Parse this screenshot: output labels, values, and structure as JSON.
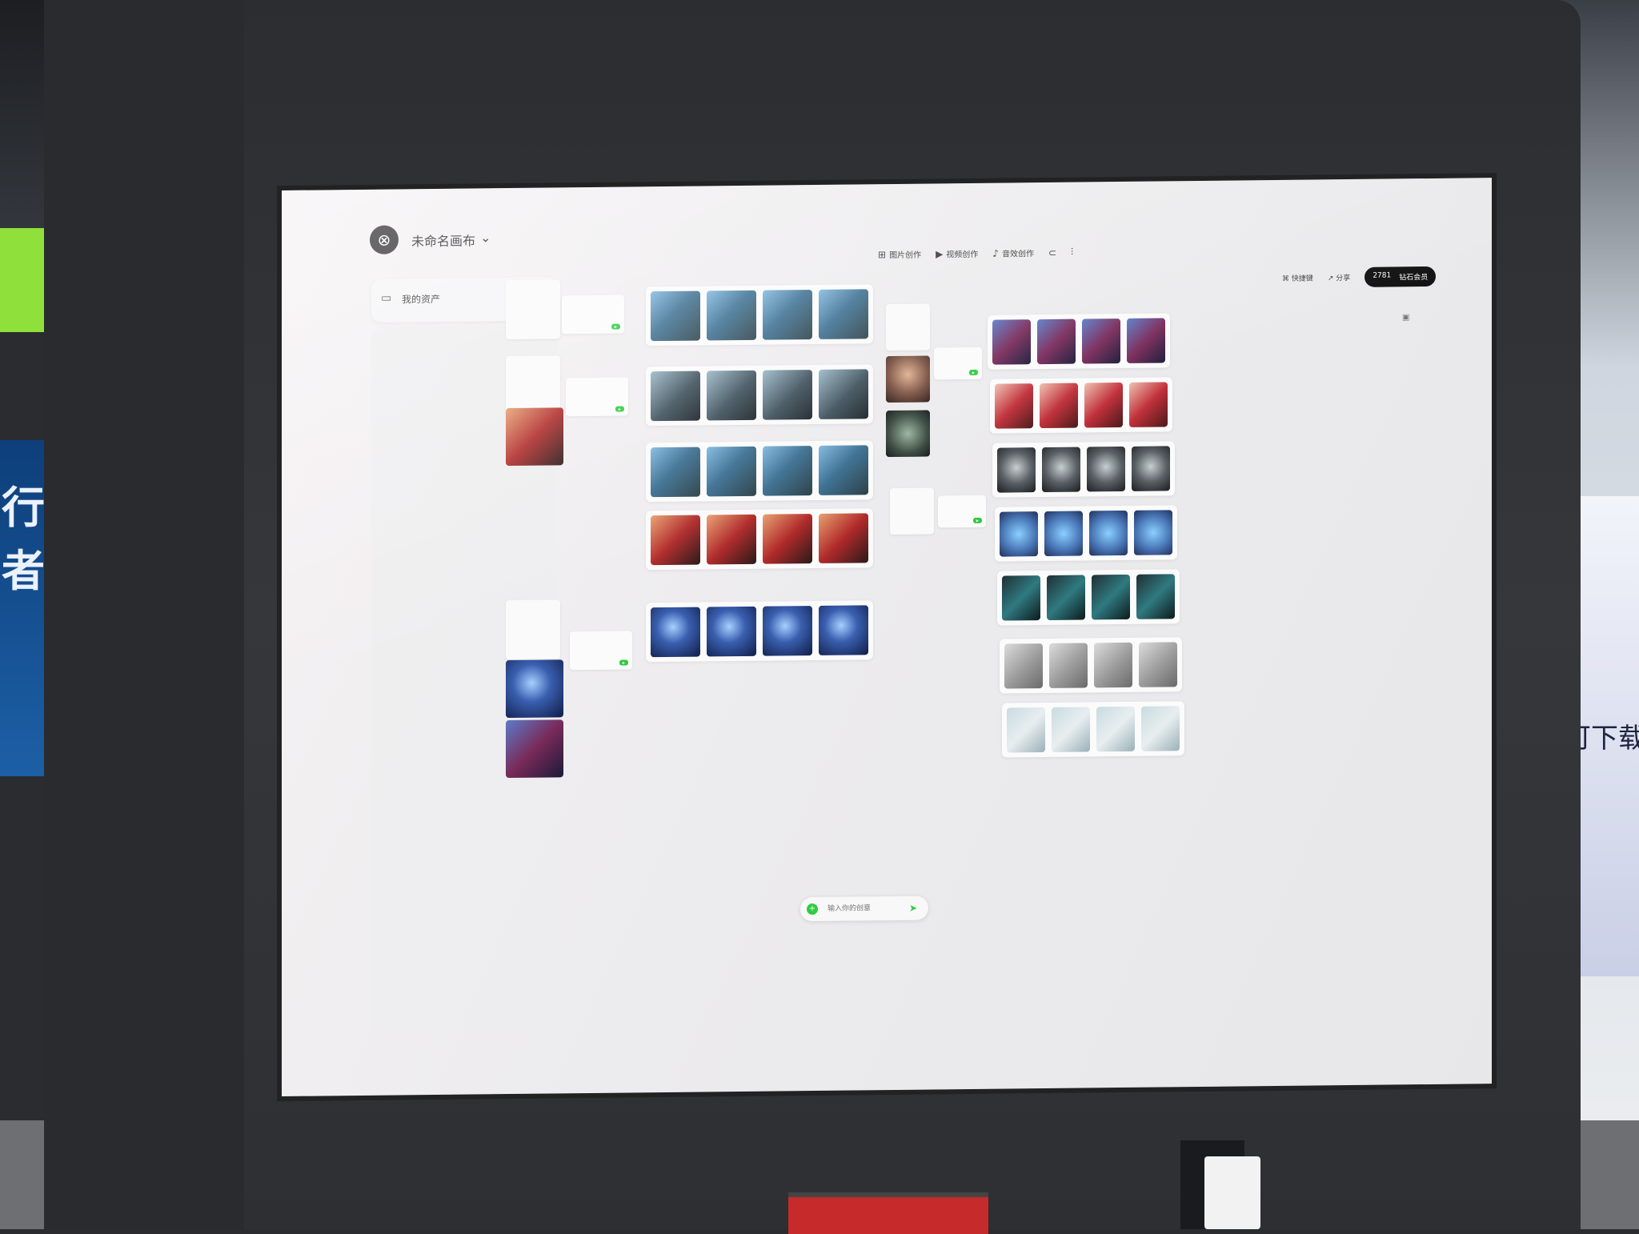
{
  "app": {
    "canvas_title": "未命名画布",
    "assets_label": "我的资产"
  },
  "toolbar": {
    "image_label": "图片创作",
    "video_label": "视频创作",
    "audio_label": "音效创作"
  },
  "top_right": {
    "shortcut_label": "快捷键",
    "share_label": "分享",
    "credits": "2781",
    "upgrade_label": "钻石会员"
  },
  "prompt": {
    "placeholder": "输入你的创意"
  },
  "background": {
    "left_sign": "行者",
    "right_sign": "即可下载"
  },
  "colors": {
    "accent": "#2ecc40",
    "kiosk": "#2d2f33",
    "screen": "#ecebed"
  }
}
